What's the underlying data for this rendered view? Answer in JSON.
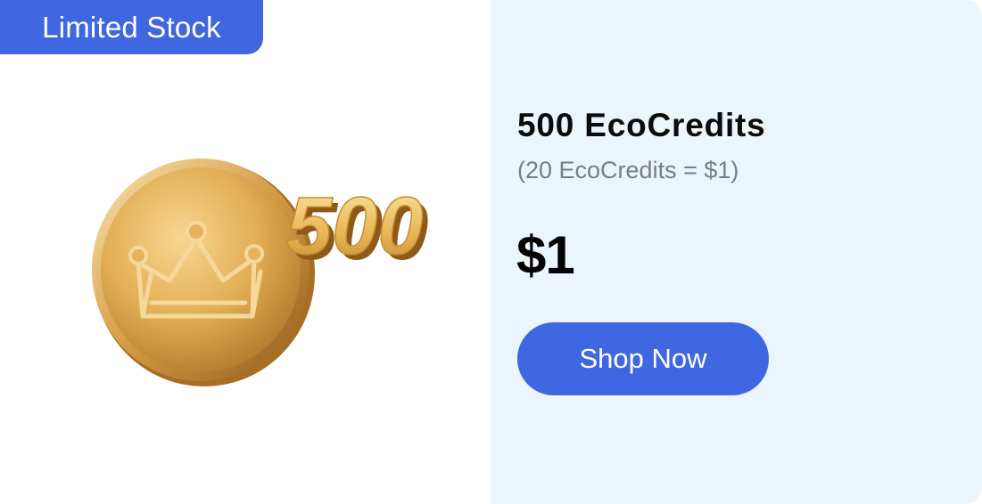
{
  "badge": {
    "label": "Limited Stock"
  },
  "coin": {
    "amount_text": "500",
    "icon": "crown-icon"
  },
  "offer": {
    "title": "500 EcoCredits",
    "rate": "(20 EcoCredits = $1)",
    "price": "$1",
    "cta_label": "Shop Now"
  },
  "colors": {
    "accent": "#3f67e1",
    "panel_bg": "#ebf5fd",
    "gold": "#e2ad55"
  }
}
